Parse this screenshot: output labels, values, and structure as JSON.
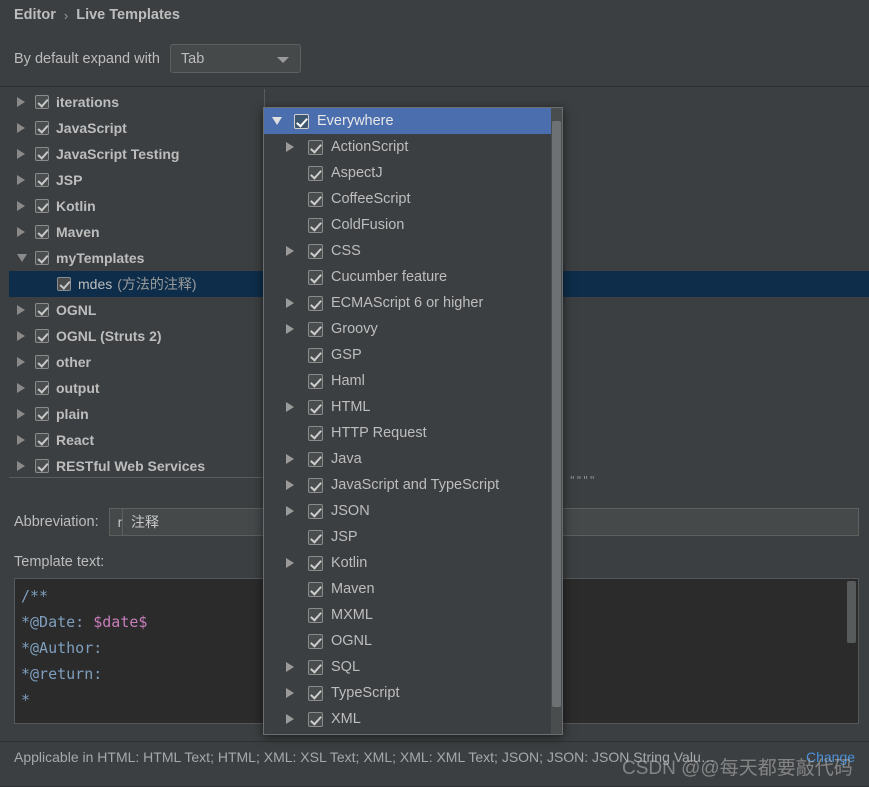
{
  "breadcrumb": {
    "parent": "Editor",
    "separator": "›",
    "current": "Live Templates"
  },
  "expand": {
    "label": "By default expand with",
    "value": "Tab",
    "arrow_icon": "chevron-down-icon"
  },
  "tree": {
    "items": [
      {
        "label": "iterations",
        "expandable": true,
        "expanded": false,
        "checked": true,
        "selected": false,
        "indent": 0
      },
      {
        "label": "JavaScript",
        "expandable": true,
        "expanded": false,
        "checked": true,
        "selected": false,
        "indent": 0
      },
      {
        "label": "JavaScript Testing",
        "expandable": true,
        "expanded": false,
        "checked": true,
        "selected": false,
        "indent": 0
      },
      {
        "label": "JSP",
        "expandable": true,
        "expanded": false,
        "checked": true,
        "selected": false,
        "indent": 0
      },
      {
        "label": "Kotlin",
        "expandable": true,
        "expanded": false,
        "checked": true,
        "selected": false,
        "indent": 0
      },
      {
        "label": "Maven",
        "expandable": true,
        "expanded": false,
        "checked": true,
        "selected": false,
        "indent": 0
      },
      {
        "label": "myTemplates",
        "expandable": true,
        "expanded": true,
        "checked": true,
        "selected": false,
        "indent": 0
      },
      {
        "label": "mdes",
        "sublabel": "(方法的注释)",
        "expandable": false,
        "checked": true,
        "selected": true,
        "indent": 1
      },
      {
        "label": "OGNL",
        "expandable": true,
        "expanded": false,
        "checked": true,
        "selected": false,
        "indent": 0
      },
      {
        "label": "OGNL (Struts 2)",
        "expandable": true,
        "expanded": false,
        "checked": true,
        "selected": false,
        "indent": 0
      },
      {
        "label": "other",
        "expandable": true,
        "expanded": false,
        "checked": true,
        "selected": false,
        "indent": 0
      },
      {
        "label": "output",
        "expandable": true,
        "expanded": false,
        "checked": true,
        "selected": false,
        "indent": 0
      },
      {
        "label": "plain",
        "expandable": true,
        "expanded": false,
        "checked": true,
        "selected": false,
        "indent": 0
      },
      {
        "label": "React",
        "expandable": true,
        "expanded": false,
        "checked": true,
        "selected": false,
        "indent": 0
      },
      {
        "label": "RESTful Web Services",
        "expandable": true,
        "expanded": false,
        "checked": true,
        "selected": false,
        "indent": 0
      }
    ]
  },
  "popup": {
    "title": "Everywhere",
    "items": [
      {
        "label": "Everywhere",
        "expandable": true,
        "expanded": true,
        "checked": true,
        "header": true
      },
      {
        "label": "ActionScript",
        "expandable": true,
        "checked": true
      },
      {
        "label": "AspectJ",
        "expandable": false,
        "checked": true
      },
      {
        "label": "CoffeeScript",
        "expandable": false,
        "checked": true
      },
      {
        "label": "ColdFusion",
        "expandable": false,
        "checked": true
      },
      {
        "label": "CSS",
        "expandable": true,
        "checked": true
      },
      {
        "label": "Cucumber feature",
        "expandable": false,
        "checked": true
      },
      {
        "label": "ECMAScript 6 or higher",
        "expandable": true,
        "checked": true
      },
      {
        "label": "Groovy",
        "expandable": true,
        "checked": true
      },
      {
        "label": "GSP",
        "expandable": false,
        "checked": true
      },
      {
        "label": "Haml",
        "expandable": false,
        "checked": true
      },
      {
        "label": "HTML",
        "expandable": true,
        "checked": true
      },
      {
        "label": "HTTP Request",
        "expandable": false,
        "checked": true
      },
      {
        "label": "Java",
        "expandable": true,
        "checked": true
      },
      {
        "label": "JavaScript and TypeScript",
        "expandable": true,
        "checked": true
      },
      {
        "label": "JSON",
        "expandable": true,
        "checked": true
      },
      {
        "label": "JSP",
        "expandable": false,
        "checked": true
      },
      {
        "label": "Kotlin",
        "expandable": true,
        "checked": true
      },
      {
        "label": "Maven",
        "expandable": false,
        "checked": true
      },
      {
        "label": "MXML",
        "expandable": false,
        "checked": true
      },
      {
        "label": "OGNL",
        "expandable": false,
        "checked": true
      },
      {
        "label": "SQL",
        "expandable": true,
        "checked": true
      },
      {
        "label": "TypeScript",
        "expandable": true,
        "checked": true
      },
      {
        "label": "XML",
        "expandable": true,
        "checked": true
      }
    ]
  },
  "form": {
    "abbreviation_label": "Abbreviation:",
    "abbreviation_value": "mdes",
    "description_value": "注释",
    "template_label": "Template text:",
    "template_lines": [
      {
        "prefix": "/**",
        "var": ""
      },
      {
        "prefix": "*@Date: ",
        "var": "$date$"
      },
      {
        "prefix": "*@Author:",
        "var": ""
      },
      {
        "prefix": "*@return:",
        "var": ""
      },
      {
        "prefix": "*",
        "var": ""
      }
    ],
    "dots": "\"\"\"\""
  },
  "status": {
    "text": "Applicable in HTML: HTML Text; HTML; XML: XSL Text; XML; XML: XML Text; JSON; JSON: JSON String Valu…",
    "change_link": "Change"
  },
  "watermark": "CSDN @@每天都要敲代码",
  "colors": {
    "background": "#3c3f41",
    "selection_blue": "#4b6eaf",
    "row_selected": "#0d2d4a",
    "link": "#4a90d9",
    "editor_bg": "#2b2b2b",
    "token_comment": "#7f9fbf",
    "token_variable": "#c77dbb"
  }
}
